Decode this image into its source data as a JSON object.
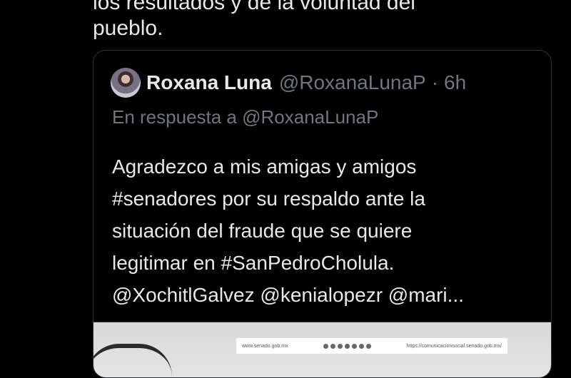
{
  "tweet": {
    "text_line_cut": "los resultados y de la voluntad del",
    "text_line2": "pueblo."
  },
  "quote": {
    "author_name": "Roxana Luna",
    "author_handle": "@RoxanaLunaP",
    "separator": "·",
    "time": "6h",
    "reply_to": "En respuesta a @RoxanaLunaP",
    "lines": [
      "Agradezco a mis amigas y amigos",
      "#senadores por su respaldo ante la",
      "situación del fraude que se quiere",
      "legitimar en #SanPedroCholula.",
      "@XochitlGalvez @kenialopezr @mari..."
    ],
    "media": {
      "banner_left": "www.senado.gob.mx",
      "banner_right": "https://comunicacionsocial.senado.gob.mx/"
    }
  },
  "colors": {
    "background": "#000000",
    "text": "#e7e9ea",
    "muted": "#71767b",
    "border": "#2f3336"
  }
}
